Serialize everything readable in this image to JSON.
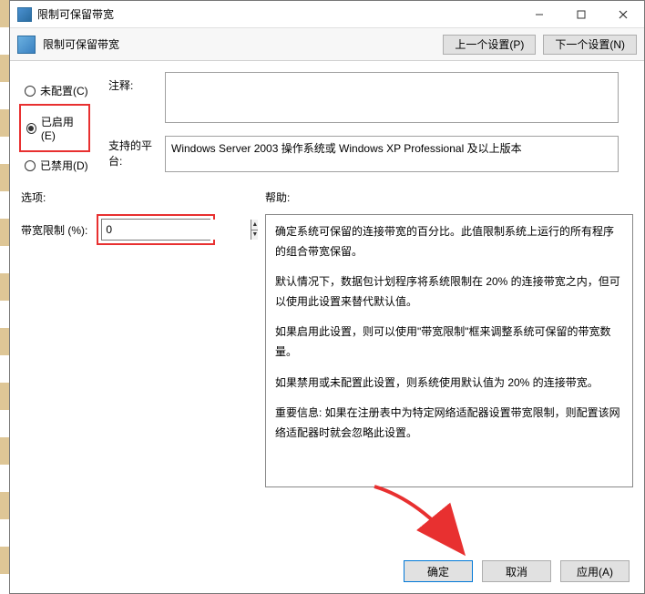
{
  "window": {
    "title": "限制可保留带宽"
  },
  "toolbar": {
    "title": "限制可保留带宽",
    "prev_btn": "上一个设置(P)",
    "next_btn": "下一个设置(N)"
  },
  "radios": {
    "not_configured": "未配置(C)",
    "enabled": "已启用(E)",
    "disabled": "已禁用(D)"
  },
  "labels": {
    "comment": "注释:",
    "platform": "支持的平台:",
    "options": "选项:",
    "help": "帮助:",
    "bandwidth_limit": "带宽限制 (%):"
  },
  "fields": {
    "comment_value": "",
    "platform_value": "Windows Server 2003 操作系统或 Windows XP Professional 及以上版本",
    "bandwidth_value": "0"
  },
  "help": {
    "p1": "确定系统可保留的连接带宽的百分比。此值限制系统上运行的所有程序的组合带宽保留。",
    "p2": "默认情况下，数据包计划程序将系统限制在 20% 的连接带宽之内，但可以使用此设置来替代默认值。",
    "p3": "如果启用此设置，则可以使用\"带宽限制\"框来调整系统可保留的带宽数量。",
    "p4": "如果禁用或未配置此设置，则系统使用默认值为 20% 的连接带宽。",
    "p5": "重要信息: 如果在注册表中为特定网络适配器设置带宽限制，则配置该网络适配器时就会忽略此设置。"
  },
  "buttons": {
    "ok": "确定",
    "cancel": "取消",
    "apply": "应用(A)"
  }
}
